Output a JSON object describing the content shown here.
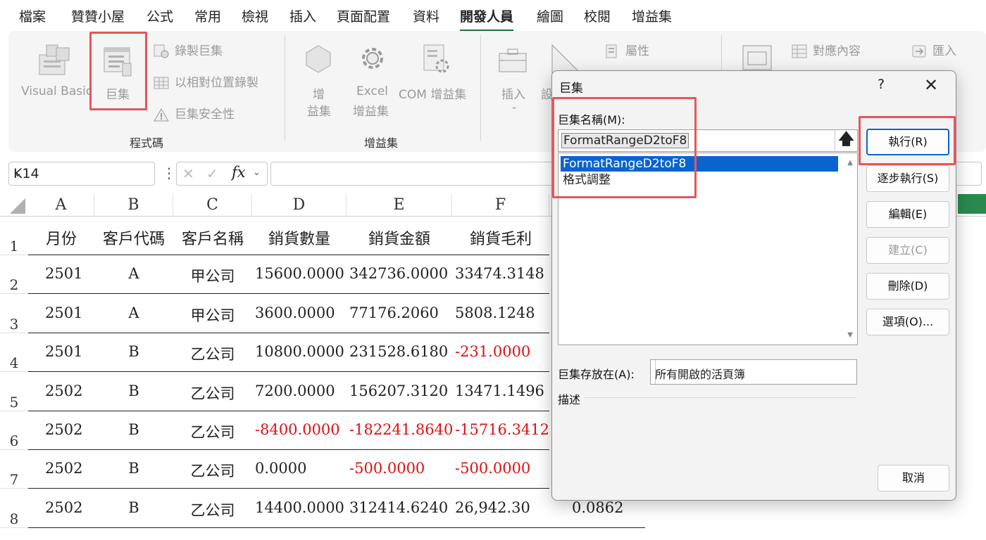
{
  "tabs": [
    "檔案",
    "贊贊小屋",
    "公式",
    "常用",
    "檢視",
    "插入",
    "頁面配置",
    "資料",
    "開發人員",
    "繪圖",
    "校閱",
    "增益集"
  ],
  "active_tab": "開發人員",
  "ribbon": {
    "code_group": {
      "visual_basic": "Visual Basic",
      "macros": "巨集",
      "record_macro": "錄製巨集",
      "relative_ref": "以相對位置錄製",
      "macro_security": "巨集安全性",
      "label": "程式碼"
    },
    "addins_group": {
      "addins_line1": "增",
      "addins_line2": "益集",
      "excel_addins_line1": "Excel",
      "excel_addins_line2": "增益集",
      "com_addins": "COM 增益集",
      "label": "增益集"
    },
    "controls_group": {
      "insert": "插入",
      "design_partial": "設",
      "properties": "屬性"
    },
    "xml_group": {
      "map_properties": "對應內容",
      "import": "匯入"
    }
  },
  "formula_bar": {
    "name_box": "K14",
    "fx": "fx",
    "formula": ""
  },
  "sheet": {
    "columns": [
      "A",
      "B",
      "C",
      "D",
      "E",
      "F"
    ],
    "rows": [
      "1",
      "2",
      "3",
      "4",
      "5",
      "6",
      "7",
      "8"
    ],
    "header": [
      "月份",
      "客戶代碼",
      "客戶名稱",
      "銷貨數量",
      "銷貨金額",
      "銷貨毛利"
    ],
    "data": [
      [
        "2501",
        "A",
        "甲公司",
        "15600.0000",
        "342736.0000",
        "33474.3148"
      ],
      [
        "2501",
        "A",
        "甲公司",
        "3600.0000",
        "77176.2060",
        "5808.1248"
      ],
      [
        "2501",
        "B",
        "乙公司",
        "10800.0000",
        "231528.6180",
        "-231.0000"
      ],
      [
        "2502",
        "B",
        "乙公司",
        "7200.0000",
        "156207.3120",
        "13471.1496"
      ],
      [
        "2502",
        "B",
        "乙公司",
        "-8400.0000",
        "-182241.8640",
        "-15716.3412"
      ],
      [
        "2502",
        "B",
        "乙公司",
        "0.0000",
        "-500.0000",
        "-500.0000"
      ],
      [
        "2502",
        "B",
        "乙公司",
        "14400.0000",
        "312414.6240",
        "26,942.30"
      ]
    ],
    "row8_g": "0.0862",
    "negative_color": "#e01010"
  },
  "dialog": {
    "title": "巨集",
    "help": "?",
    "close": "✕",
    "name_label": "巨集名稱(M):",
    "name_value": "FormatRangeD2toF8",
    "macros": [
      "FormatRangeD2toF8",
      "格式調整"
    ],
    "selected_index": 0,
    "buttons": {
      "run": "執行(R)",
      "step_into": "逐步執行(S)",
      "edit": "編輯(E)",
      "create": "建立(C)",
      "delete": "刪除(D)",
      "options": "選項(O)...",
      "cancel": "取消"
    },
    "macros_in_label": "巨集存放在(A):",
    "macros_in_value": "所有開啟的活頁簿",
    "description_label": "描述"
  },
  "colors": {
    "accent": "#0a64d0",
    "highlight": "#e8555a",
    "active_tab_underline": "#1f6f3a"
  }
}
